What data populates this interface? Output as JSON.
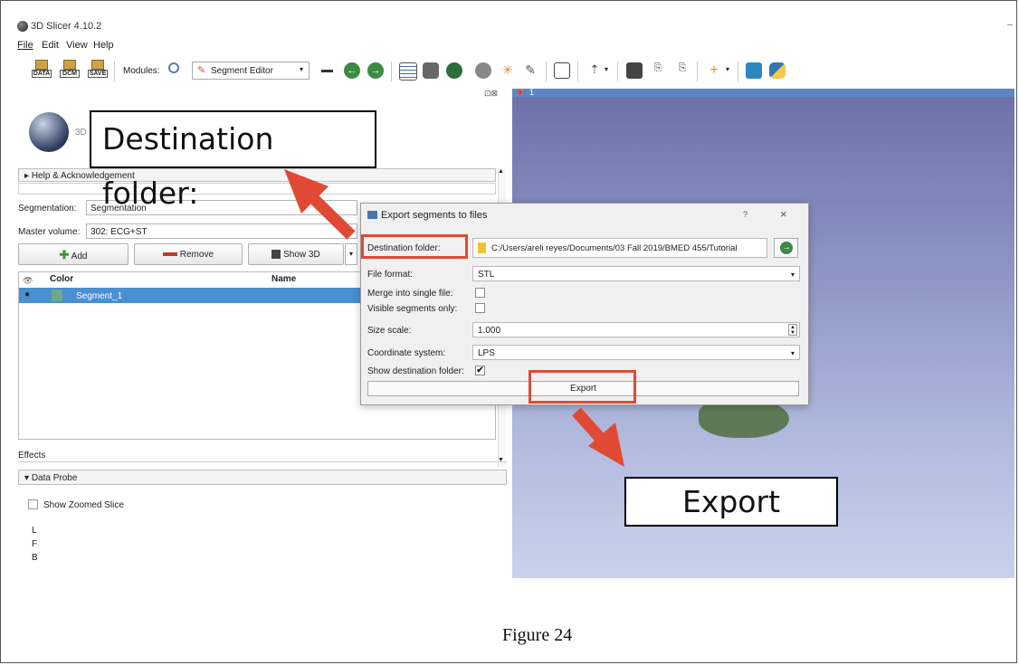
{
  "window": {
    "title": "3D Slicer 4.10.2"
  },
  "menu": [
    "File",
    "Edit",
    "View",
    "Help"
  ],
  "toolbar": {
    "data_label": "DATA",
    "dcm_label": "DCM",
    "save_label": "SAVE",
    "modules_label": "Modules:",
    "module_selected": "Segment Editor"
  },
  "viewer": {
    "slice_label": "1"
  },
  "left_panel": {
    "logo_text": "3D",
    "help_section": "Help & Acknowledgement",
    "segmentation_label": "Segmentation:",
    "segmentation_value": "Segmentation",
    "master_volume_label": "Master volume:",
    "master_volume_value": "302: ECG+ST",
    "add_button": "Add",
    "remove_button": "Remove",
    "show3d_button": "Show 3D",
    "table_headers": {
      "color": "Color",
      "name": "Name"
    },
    "segments": [
      {
        "name": "Segment_1",
        "color": "#6fa88c"
      }
    ],
    "effects_label": "Effects",
    "data_probe_label": "Data Probe",
    "show_zoomed_slice": "Show Zoomed Slice",
    "probe_rows": [
      "L",
      "F",
      "B"
    ]
  },
  "dialog": {
    "title": "Export segments to files",
    "help_btn": "?",
    "close_btn": "×",
    "destination_label": "Destination folder:",
    "destination_value": "C:/Users/areli reyes/Documents/03 Fall 2019/BMED 455/Tutorial",
    "file_format_label": "File format:",
    "file_format_value": "STL",
    "merge_label": "Merge into single file:",
    "merge_checked": false,
    "visible_only_label": "Visible segments only:",
    "visible_only_checked": false,
    "size_scale_label": "Size scale:",
    "size_scale_value": "1.000",
    "coord_label": "Coordinate system:",
    "coord_value": "LPS",
    "show_dest_label": "Show destination folder:",
    "show_dest_checked": true,
    "export_button": "Export"
  },
  "callouts": {
    "destination": "Destination folder:",
    "export": "Export"
  },
  "caption": "Figure 24",
  "colors": {
    "highlight": "#e04a34",
    "selection": "#4a8fd0",
    "viewer_top": "#6a6fa8",
    "viewer_bottom": "#c7cfe8",
    "segment_model": "#5d7a56"
  }
}
